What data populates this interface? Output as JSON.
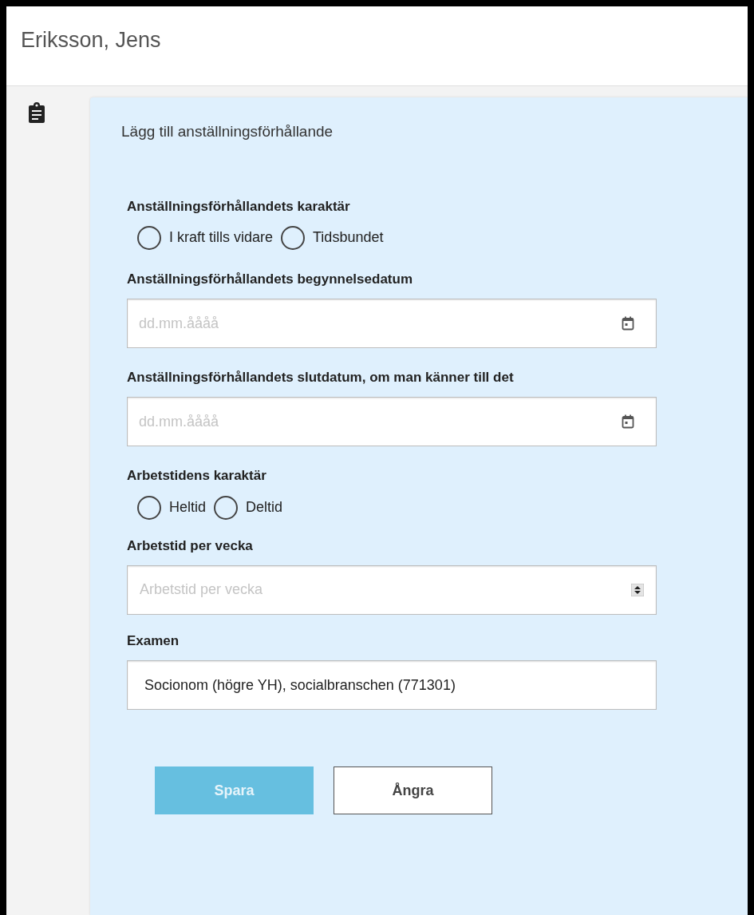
{
  "header": {
    "title": "Eriksson, Jens"
  },
  "form": {
    "title": "Lägg till anställningsförhållande",
    "sections": [
      {
        "kind": "radio",
        "label": "Anställningsförhållandets karaktär",
        "options": [
          {
            "label": "I kraft tills vidare",
            "selected": false
          },
          {
            "label": "Tidsbundet",
            "selected": false
          }
        ]
      },
      {
        "kind": "date",
        "label": "Anställningsförhållandets begynnelsedatum",
        "placeholder": "dd.mm.åååå"
      },
      {
        "kind": "date",
        "label": "Anställningsförhållandets slutdatum, om man känner till det",
        "placeholder": "dd.mm.åååå"
      },
      {
        "kind": "radio",
        "label": "Arbetstidens karaktär",
        "options": [
          {
            "label": "Heltid",
            "selected": false
          },
          {
            "label": "Deltid",
            "selected": false
          }
        ]
      },
      {
        "kind": "number",
        "label": "Arbetstid per vecka",
        "placeholder": "Arbetstid per vecka"
      },
      {
        "kind": "text",
        "label": "Examen",
        "value": "Socionom (högre YH), socialbranschen (771301)"
      }
    ],
    "buttons": [
      {
        "label": "Spara",
        "kind": "primary",
        "disabled": true
      },
      {
        "label": "Ångra",
        "kind": "secondary",
        "disabled": false
      }
    ]
  }
}
